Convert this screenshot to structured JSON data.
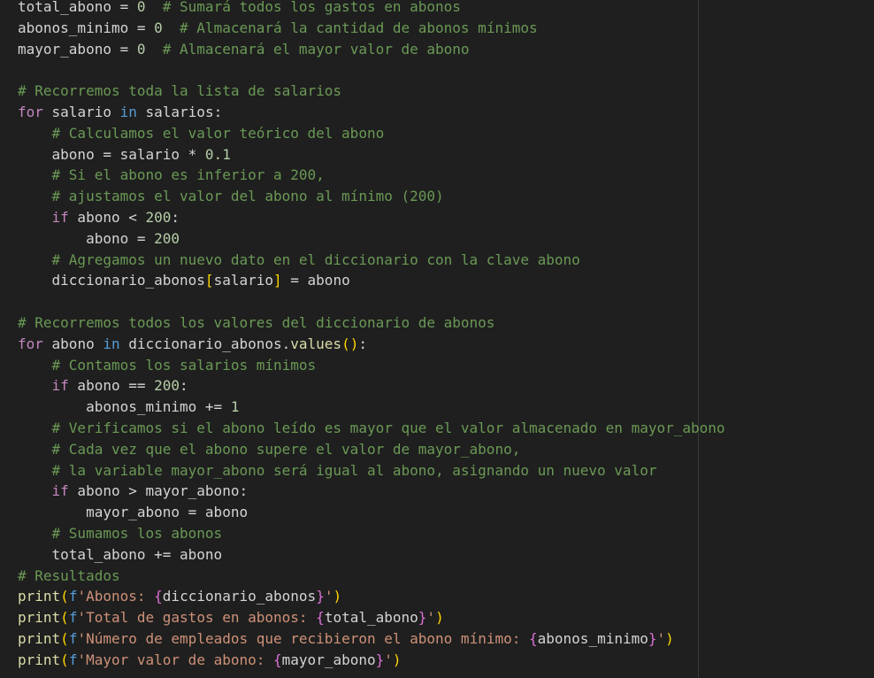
{
  "theme": {
    "background": "#1f1f1f",
    "ruler": "#3a3a3a",
    "colors": {
      "cm": "#6a9955",
      "kw": "#c586c0",
      "bi": "#569cd6",
      "fn": "#dcdcaa",
      "str": "#ce9178",
      "num": "#b5cea8",
      "var": "#d4d4d4",
      "br1": "#ffd700",
      "br2": "#da70d6",
      "pn": "#d4d4d4"
    }
  },
  "lines": [
    [
      [
        "var",
        "total_abono = "
      ],
      [
        "num",
        "0"
      ],
      [
        "var",
        "  "
      ],
      [
        "cm",
        "# Sumará todos los gastos en abonos"
      ]
    ],
    [
      [
        "var",
        "abonos_minimo = "
      ],
      [
        "num",
        "0"
      ],
      [
        "var",
        "  "
      ],
      [
        "cm",
        "# Almacenará la cantidad de abonos mínimos"
      ]
    ],
    [
      [
        "var",
        "mayor_abono = "
      ],
      [
        "num",
        "0"
      ],
      [
        "var",
        "  "
      ],
      [
        "cm",
        "# Almacenará el mayor valor de abono"
      ]
    ],
    [],
    [
      [
        "cm",
        "# Recorremos toda la lista de salarios"
      ]
    ],
    [
      [
        "kw",
        "for"
      ],
      [
        "var",
        " salario "
      ],
      [
        "bi",
        "in"
      ],
      [
        "var",
        " salarios:"
      ]
    ],
    [
      [
        "var",
        "    "
      ],
      [
        "cm",
        "# Calculamos el valor teórico del abono"
      ]
    ],
    [
      [
        "var",
        "    abono = salario * "
      ],
      [
        "num",
        "0.1"
      ]
    ],
    [
      [
        "var",
        "    "
      ],
      [
        "cm",
        "# Si el abono es inferior a 200,"
      ]
    ],
    [
      [
        "var",
        "    "
      ],
      [
        "cm",
        "# ajustamos el valor del abono al mínimo (200)"
      ]
    ],
    [
      [
        "var",
        "    "
      ],
      [
        "kw",
        "if"
      ],
      [
        "var",
        " abono < "
      ],
      [
        "num",
        "200"
      ],
      [
        "var",
        ":"
      ]
    ],
    [
      [
        "var",
        "        abono = "
      ],
      [
        "num",
        "200"
      ]
    ],
    [
      [
        "var",
        "    "
      ],
      [
        "cm",
        "# Agregamos un nuevo dato en el diccionario con la clave abono"
      ]
    ],
    [
      [
        "var",
        "    diccionario_abonos"
      ],
      [
        "br1",
        "["
      ],
      [
        "var",
        "salario"
      ],
      [
        "br1",
        "]"
      ],
      [
        "var",
        " = abono"
      ]
    ],
    [],
    [
      [
        "cm",
        "# Recorremos todos los valores del diccionario de abonos"
      ]
    ],
    [
      [
        "kw",
        "for"
      ],
      [
        "var",
        " abono "
      ],
      [
        "bi",
        "in"
      ],
      [
        "var",
        " diccionario_abonos."
      ],
      [
        "fn",
        "values"
      ],
      [
        "br1",
        "()"
      ],
      [
        "var",
        ":"
      ]
    ],
    [
      [
        "var",
        "    "
      ],
      [
        "cm",
        "# Contamos los salarios mínimos"
      ]
    ],
    [
      [
        "var",
        "    "
      ],
      [
        "kw",
        "if"
      ],
      [
        "var",
        " abono == "
      ],
      [
        "num",
        "200"
      ],
      [
        "var",
        ":"
      ]
    ],
    [
      [
        "var",
        "        abonos_minimo += "
      ],
      [
        "num",
        "1"
      ]
    ],
    [
      [
        "var",
        "    "
      ],
      [
        "cm",
        "# Verificamos si el abono leído es mayor que el valor almacenado en mayor_abono"
      ]
    ],
    [
      [
        "var",
        "    "
      ],
      [
        "cm",
        "# Cada vez que el abono supere el valor de mayor_abono,"
      ]
    ],
    [
      [
        "var",
        "    "
      ],
      [
        "cm",
        "# la variable mayor_abono será igual al abono, asignando un nuevo valor"
      ]
    ],
    [
      [
        "var",
        "    "
      ],
      [
        "kw",
        "if"
      ],
      [
        "var",
        " abono > mayor_abono:"
      ]
    ],
    [
      [
        "var",
        "        mayor_abono = abono"
      ]
    ],
    [
      [
        "var",
        "    "
      ],
      [
        "cm",
        "# Sumamos los abonos"
      ]
    ],
    [
      [
        "var",
        "    total_abono += abono"
      ]
    ],
    [
      [
        "cm",
        "# Resultados"
      ]
    ],
    [
      [
        "fn",
        "print"
      ],
      [
        "br1",
        "("
      ],
      [
        "bi",
        "f"
      ],
      [
        "str",
        "'Abonos: "
      ],
      [
        "br2",
        "{"
      ],
      [
        "var",
        "diccionario_abonos"
      ],
      [
        "br2",
        "}"
      ],
      [
        "str",
        "'"
      ],
      [
        "br1",
        ")"
      ]
    ],
    [
      [
        "fn",
        "print"
      ],
      [
        "br1",
        "("
      ],
      [
        "bi",
        "f"
      ],
      [
        "str",
        "'Total de gastos en abonos: "
      ],
      [
        "br2",
        "{"
      ],
      [
        "var",
        "total_abono"
      ],
      [
        "br2",
        "}"
      ],
      [
        "str",
        "'"
      ],
      [
        "br1",
        ")"
      ]
    ],
    [
      [
        "fn",
        "print"
      ],
      [
        "br1",
        "("
      ],
      [
        "bi",
        "f"
      ],
      [
        "str",
        "'Número de empleados que recibieron el abono mínimo: "
      ],
      [
        "br2",
        "{"
      ],
      [
        "var",
        "abonos_minimo"
      ],
      [
        "br2",
        "}"
      ],
      [
        "str",
        "'"
      ],
      [
        "br1",
        ")"
      ]
    ],
    [
      [
        "fn",
        "print"
      ],
      [
        "br1",
        "("
      ],
      [
        "bi",
        "f"
      ],
      [
        "str",
        "'Mayor valor de abono: "
      ],
      [
        "br2",
        "{"
      ],
      [
        "var",
        "mayor_abono"
      ],
      [
        "br2",
        "}"
      ],
      [
        "str",
        "'"
      ],
      [
        "br1",
        ")"
      ]
    ]
  ]
}
